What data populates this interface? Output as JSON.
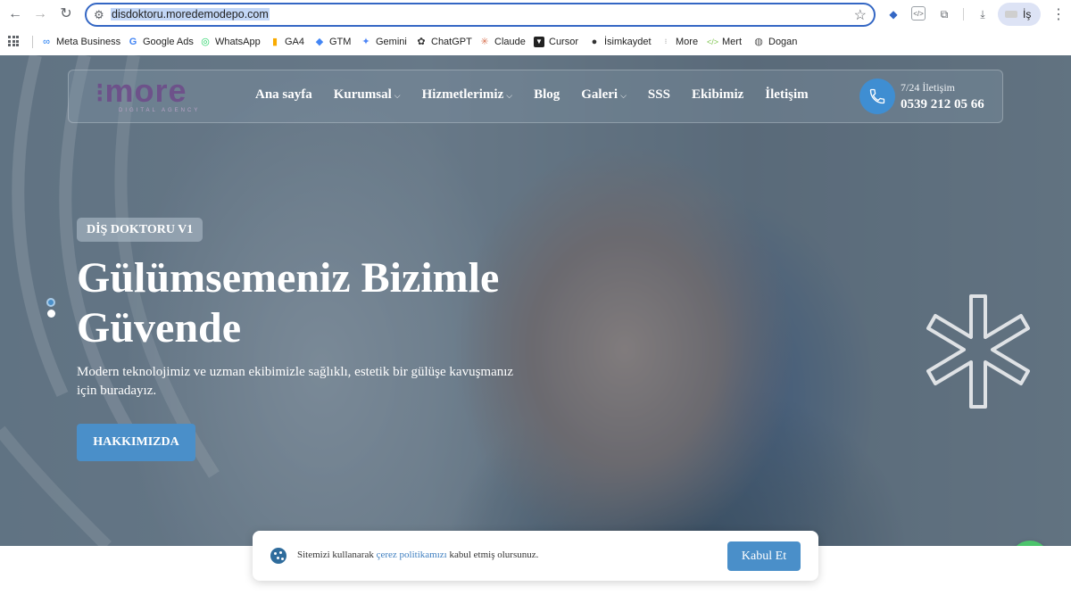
{
  "browser": {
    "url": "disdoktoru.moredemodepo.com",
    "profile_label": "İş"
  },
  "bookmarks": [
    {
      "label": "Meta Business",
      "icon": "meta-icon"
    },
    {
      "label": "Google Ads",
      "icon": "google-icon"
    },
    {
      "label": "WhatsApp",
      "icon": "whatsapp-icon"
    },
    {
      "label": "GA4",
      "icon": "ga4-icon"
    },
    {
      "label": "GTM",
      "icon": "gtm-icon"
    },
    {
      "label": "Gemini",
      "icon": "gemini-icon"
    },
    {
      "label": "ChatGPT",
      "icon": "chatgpt-icon"
    },
    {
      "label": "Claude",
      "icon": "claude-icon"
    },
    {
      "label": "Cursor",
      "icon": "cursor-icon"
    },
    {
      "label": "İsimkaydet",
      "icon": "isimkaydet-icon"
    },
    {
      "label": "More",
      "icon": "more-icon"
    },
    {
      "label": "Mert",
      "icon": "code-icon"
    },
    {
      "label": "Dogan",
      "icon": "globe-icon"
    }
  ],
  "header": {
    "logo_text": "more",
    "logo_sub": "DIGITAL AGENCY",
    "menu": [
      {
        "label": "Ana sayfa",
        "dropdown": false
      },
      {
        "label": "Kurumsal",
        "dropdown": true
      },
      {
        "label": "Hizmetlerimiz",
        "dropdown": true
      },
      {
        "label": "Blog",
        "dropdown": false
      },
      {
        "label": "Galeri",
        "dropdown": true
      },
      {
        "label": "SSS",
        "dropdown": false
      },
      {
        "label": "Ekibimiz",
        "dropdown": false
      },
      {
        "label": "İletişim",
        "dropdown": false
      }
    ],
    "contact_label": "7/24 İletişim",
    "phone": "0539 212 05 66"
  },
  "hero": {
    "badge": "DİŞ DOKTORU V1",
    "title_line1": "Gülümsemeniz Bizimle",
    "title_line2": "Güvende",
    "subtitle": "Modern teknolojimiz ve uzman ekibimizle sağlıklı, estetik bir gülüşe kavuşmanız için buradayız.",
    "cta": "HAKKIMIZDA"
  },
  "cookie": {
    "text_before": "Sitemizi kullanarak ",
    "link": "çerez politikamızı",
    "text_after": " kabul etmiş olursunuz.",
    "accept": "Kabul Et"
  },
  "colors": {
    "accent": "#4a8fc9",
    "whatsapp": "#4cc46c",
    "logo": "#6e4a8a"
  }
}
